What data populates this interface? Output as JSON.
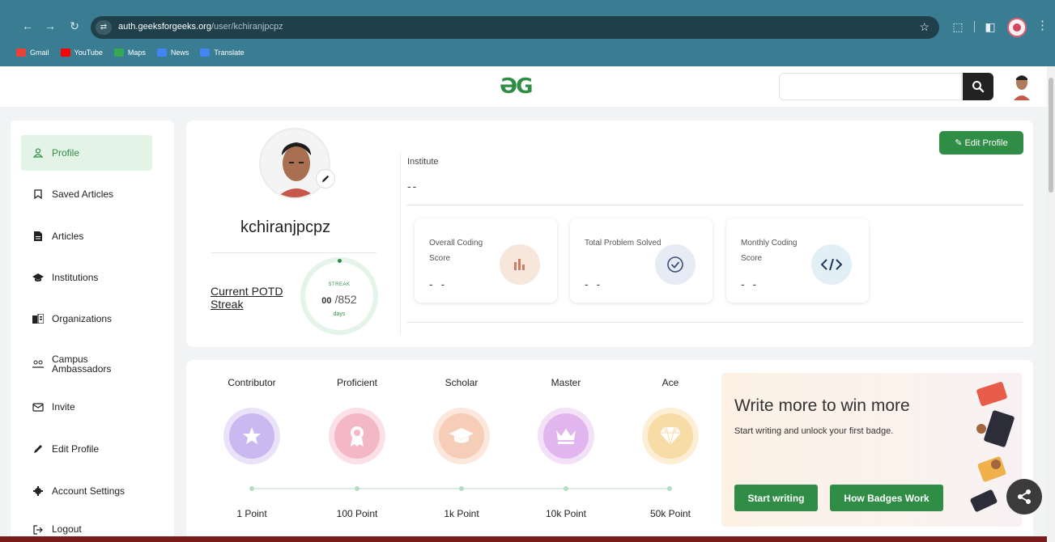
{
  "browser": {
    "url_domain": "auth.geeksforgeeks.org",
    "url_path": "/user/kchiranjpcpz",
    "bookmarks": [
      {
        "label": "Gmail",
        "color": "#ea4335"
      },
      {
        "label": "YouTube",
        "color": "#ff0000"
      },
      {
        "label": "Maps",
        "color": "#34a853"
      },
      {
        "label": "News",
        "color": "#4285f4"
      },
      {
        "label": "Translate",
        "color": "#4285f4"
      }
    ]
  },
  "header": {
    "logo_text": "ƏG",
    "search_placeholder": ""
  },
  "sidebar": {
    "items": [
      {
        "label": "Profile",
        "icon": "user-icon",
        "active": true
      },
      {
        "label": "Saved Articles",
        "icon": "bookmark-icon"
      },
      {
        "label": "Articles",
        "icon": "document-icon"
      },
      {
        "label": "Institutions",
        "icon": "graduation-cap-icon"
      },
      {
        "label": "Organizations",
        "icon": "building-icon"
      },
      {
        "label": "Campus Ambassadors",
        "icon": "group-icon"
      },
      {
        "label": "Invite",
        "icon": "mail-icon"
      },
      {
        "label": "Edit Profile",
        "icon": "pencil-icon"
      },
      {
        "label": "Account Settings",
        "icon": "gear-icon"
      },
      {
        "label": "Logout",
        "icon": "logout-icon"
      }
    ]
  },
  "profile": {
    "username": "kchiranjpcpz",
    "institute_label": "Institute",
    "institute_value": "--",
    "edit_button": "Edit Profile",
    "potd_label": "Current POTD Streak",
    "streak_label": "STREAK",
    "streak_current": "00",
    "streak_total": "/852",
    "streak_unit": "days"
  },
  "stats": [
    {
      "title": "Overall Coding Score",
      "value": "- -",
      "icon": "bar-chart-icon",
      "color": "#f7e6dc"
    },
    {
      "title": "Total Problem Solved",
      "value": "- -",
      "icon": "check-circle-icon",
      "color": "#e6ebf5"
    },
    {
      "title": "Monthly Coding Score",
      "value": "- -",
      "icon": "code-icon",
      "color": "#e3eff7"
    }
  ],
  "badges": [
    {
      "name": "Contributor",
      "points": "1 Point",
      "icon": "star-icon",
      "color": "#c9b9f0"
    },
    {
      "name": "Proficient",
      "points": "100 Point",
      "icon": "ribbon-icon",
      "color": "#f4b7c6"
    },
    {
      "name": "Scholar",
      "points": "1k Point",
      "icon": "graduation-cap-icon",
      "color": "#f6cdb6"
    },
    {
      "name": "Master",
      "points": "10k Point",
      "icon": "crown-icon",
      "color": "#e1b6ee"
    },
    {
      "name": "Ace",
      "points": "50k Point",
      "icon": "diamond-icon",
      "color": "#f7dca6"
    }
  ],
  "write": {
    "title": "Write more to win more",
    "subtitle": "Start writing and unlock your first badge.",
    "start_button": "Start writing",
    "badges_button": "How Badges Work"
  }
}
